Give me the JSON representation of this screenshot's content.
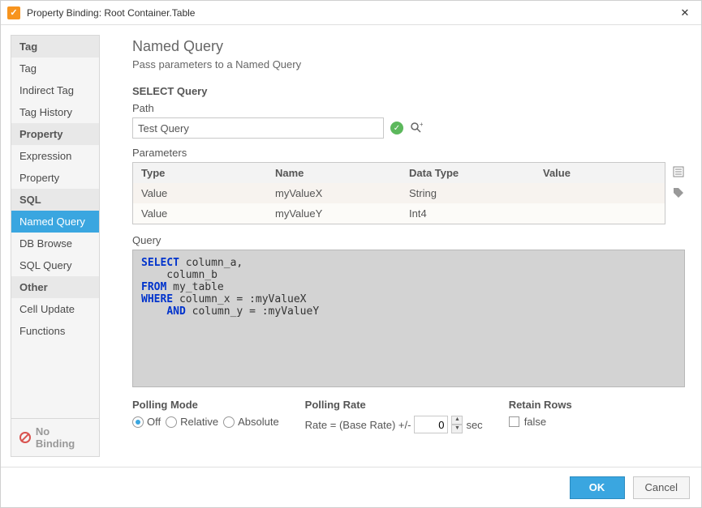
{
  "titlebar": {
    "title": "Property Binding: Root Container.Table",
    "close": "✕"
  },
  "sidebar": {
    "groups": [
      {
        "header": "Tag",
        "items": [
          "Tag",
          "Indirect Tag",
          "Tag History"
        ]
      },
      {
        "header": "Property",
        "items": [
          "Expression",
          "Property"
        ]
      },
      {
        "header": "SQL",
        "items": [
          "Named Query",
          "DB Browse",
          "SQL Query"
        ]
      },
      {
        "header": "Other",
        "items": [
          "Cell Update",
          "Functions"
        ]
      }
    ],
    "active": "Named Query",
    "no_binding": "No Binding"
  },
  "main": {
    "title": "Named Query",
    "subtitle": "Pass parameters to a Named Query",
    "select_query_header": "SELECT Query",
    "path_label": "Path",
    "path_value": "Test Query",
    "parameters_label": "Parameters",
    "table_headers": {
      "type": "Type",
      "name": "Name",
      "datatype": "Data Type",
      "value": "Value"
    },
    "table_rows": [
      {
        "type": "Value",
        "name": "myValueX",
        "datatype": "String",
        "value": ""
      },
      {
        "type": "Value",
        "name": "myValueY",
        "datatype": "Int4",
        "value": ""
      }
    ],
    "query_label": "Query",
    "query_tokens": [
      {
        "t": "kw",
        "v": "SELECT"
      },
      {
        "t": "tx",
        "v": " column_a,\n    column_b\n"
      },
      {
        "t": "kw",
        "v": "FROM"
      },
      {
        "t": "tx",
        "v": " my_table\n"
      },
      {
        "t": "kw",
        "v": "WHERE"
      },
      {
        "t": "tx",
        "v": " column_x = :myValueX\n    "
      },
      {
        "t": "kw",
        "v": "AND"
      },
      {
        "t": "tx",
        "v": " column_y = :myValueY"
      }
    ],
    "polling_mode": {
      "label": "Polling Mode",
      "options": [
        "Off",
        "Relative",
        "Absolute"
      ],
      "selected": "Off"
    },
    "polling_rate": {
      "label": "Polling Rate",
      "prefix": "Rate = (Base Rate) +/-",
      "value": "0",
      "suffix": "sec"
    },
    "retain_rows": {
      "label": "Retain Rows",
      "text": "false",
      "checked": false
    }
  },
  "footer": {
    "ok": "OK",
    "cancel": "Cancel"
  }
}
